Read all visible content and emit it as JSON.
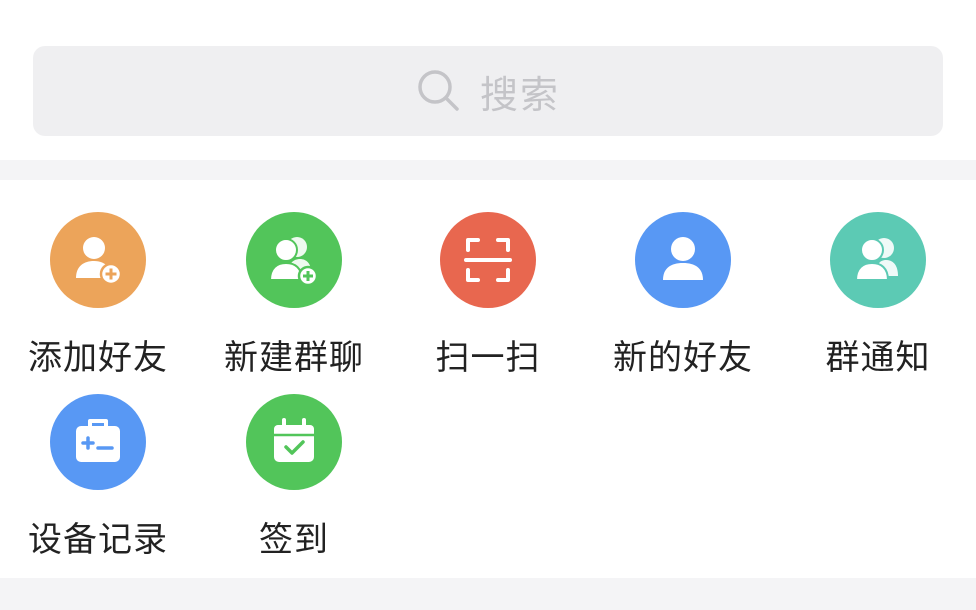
{
  "search": {
    "placeholder": "搜索"
  },
  "actions": [
    {
      "label": "添加好友",
      "icon": "add-friend-icon",
      "color": "#eca45a"
    },
    {
      "label": "新建群聊",
      "icon": "new-group-icon",
      "color": "#52c55a"
    },
    {
      "label": "扫一扫",
      "icon": "scan-icon",
      "color": "#e8674f"
    },
    {
      "label": "新的好友",
      "icon": "new-friends-icon",
      "color": "#5898f4"
    },
    {
      "label": "群通知",
      "icon": "group-notice-icon",
      "color": "#5ccab4"
    },
    {
      "label": "设备记录",
      "icon": "device-record-icon",
      "color": "#5898f4"
    },
    {
      "label": "签到",
      "icon": "checkin-icon",
      "color": "#52c55a"
    }
  ]
}
